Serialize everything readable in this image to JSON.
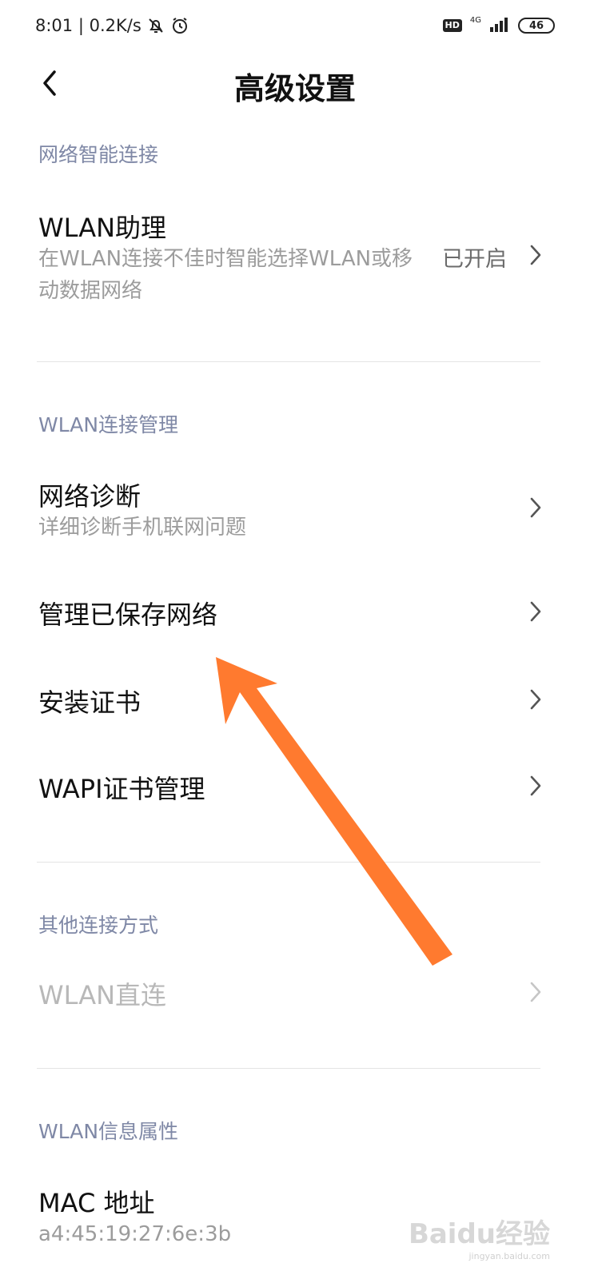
{
  "status_bar": {
    "time_speed": "8:01 | 0.2K/s",
    "hd": "HD",
    "network": "4G",
    "battery": "46"
  },
  "header": {
    "title": "高级设置"
  },
  "sections": {
    "smart_connect": {
      "title": "网络智能连接",
      "wlan_assistant": {
        "title": "WLAN助理",
        "subtitle": "在WLAN连接不佳时智能选择WLAN或移动数据网络",
        "value": "已开启"
      }
    },
    "wlan_manage": {
      "title": "WLAN连接管理",
      "diagnosis": {
        "title": "网络诊断",
        "subtitle": "详细诊断手机联网问题"
      },
      "saved_networks": {
        "title": "管理已保存网络"
      },
      "install_cert": {
        "title": "安装证书"
      },
      "wapi_cert": {
        "title": "WAPI证书管理"
      }
    },
    "other_connect": {
      "title": "其他连接方式",
      "wlan_direct": {
        "title": "WLAN直连"
      }
    },
    "wlan_info": {
      "title": "WLAN信息属性",
      "mac": {
        "title": "MAC 地址",
        "value": "a4:45:19:27:6e:3b"
      }
    }
  },
  "watermark": {
    "brand": "Baidu经验",
    "site": "jingyan.baidu.com"
  },
  "colors": {
    "section_title": "#7f88a6",
    "annotation_arrow": "#ff7a2f",
    "disabled_text": "#b8b8b8"
  },
  "icons": {
    "back": "chevron-left-icon",
    "row": "chevron-right-icon",
    "mute": "bell-off-icon",
    "alarm": "alarm-clock-icon",
    "signal": "signal-bars-icon"
  }
}
